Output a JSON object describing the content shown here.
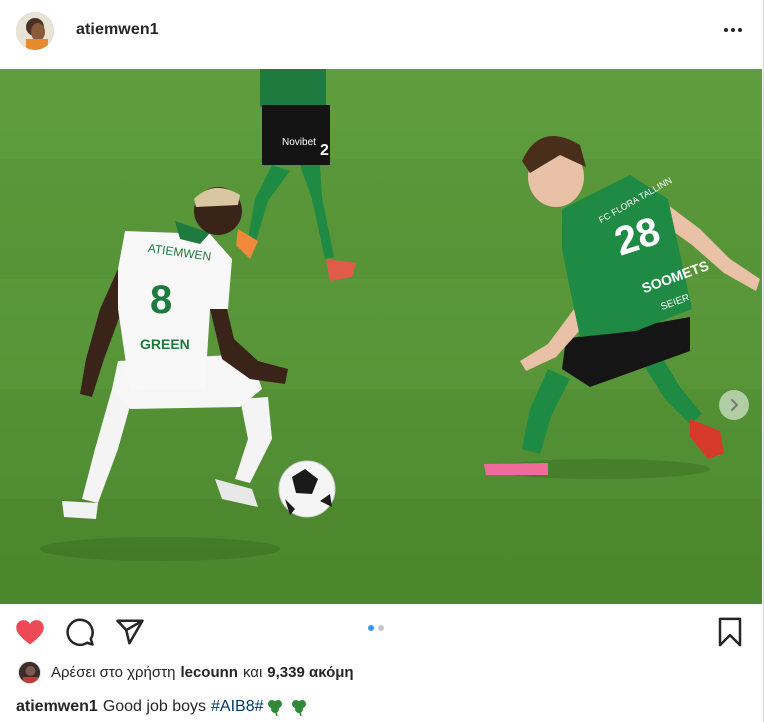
{
  "post": {
    "username": "atiemwen1",
    "more_icon": "more-horizontal-icon"
  },
  "photo": {
    "jersey_left_name": "ATIEMWEN",
    "jersey_left_number": "8",
    "jersey_left_sponsor": "GREEN",
    "jersey_right_number": "28",
    "jersey_right_name": "SOOMETS",
    "jersey_right_chest": "FC FLORA TALLINN",
    "jersey_right_sponsor": "SEIER"
  },
  "carousel": {
    "count": 2,
    "active_index": 0
  },
  "actions": {
    "like_icon": "heart-filled-icon",
    "comment_icon": "comment-icon",
    "share_icon": "share-icon",
    "save_icon": "bookmark-icon",
    "like_color": "#ed4956"
  },
  "likes": {
    "prefix": "Αρέσει στο χρήστη",
    "user": "lecounn",
    "conj": "και",
    "count": "9,339 ακόμη"
  },
  "caption": {
    "username": "atiemwen1",
    "text": "Good job boys",
    "hashtag": "#AIB8#",
    "emoji": "shamrock-icon"
  }
}
